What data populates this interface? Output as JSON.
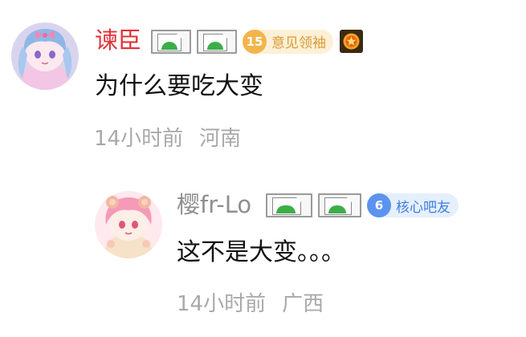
{
  "comment": {
    "username": "谏臣",
    "username_color": "#e0323a",
    "badge": {
      "level": "15",
      "title": "意见领袖",
      "color": "#f3b44b"
    },
    "medal_icon": "star-medal-icon",
    "text": "为什么要吃大变",
    "time": "14小时前",
    "location": "河南"
  },
  "reply": {
    "username": "樱fr-Lo",
    "username_color": "#8f8f8f",
    "badge": {
      "level": "6",
      "title": "核心吧友",
      "color": "#5b93ef"
    },
    "text": "这不是大变。。。",
    "time": "14小时前",
    "location": "广西"
  }
}
